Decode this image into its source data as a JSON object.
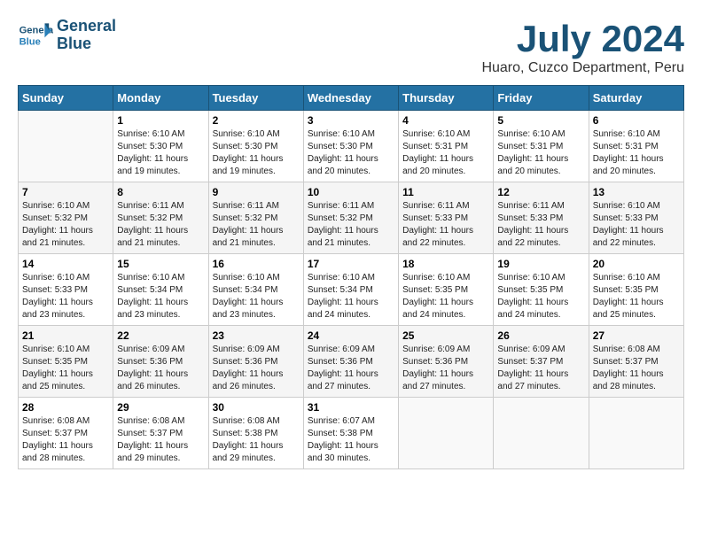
{
  "logo": {
    "line1": "General",
    "line2": "Blue"
  },
  "title": "July 2024",
  "location": "Huaro, Cuzco Department, Peru",
  "days_of_week": [
    "Sunday",
    "Monday",
    "Tuesday",
    "Wednesday",
    "Thursday",
    "Friday",
    "Saturday"
  ],
  "weeks": [
    [
      {
        "num": "",
        "sunrise": "",
        "sunset": "",
        "daylight": ""
      },
      {
        "num": "1",
        "sunrise": "Sunrise: 6:10 AM",
        "sunset": "Sunset: 5:30 PM",
        "daylight": "Daylight: 11 hours and 19 minutes."
      },
      {
        "num": "2",
        "sunrise": "Sunrise: 6:10 AM",
        "sunset": "Sunset: 5:30 PM",
        "daylight": "Daylight: 11 hours and 19 minutes."
      },
      {
        "num": "3",
        "sunrise": "Sunrise: 6:10 AM",
        "sunset": "Sunset: 5:30 PM",
        "daylight": "Daylight: 11 hours and 20 minutes."
      },
      {
        "num": "4",
        "sunrise": "Sunrise: 6:10 AM",
        "sunset": "Sunset: 5:31 PM",
        "daylight": "Daylight: 11 hours and 20 minutes."
      },
      {
        "num": "5",
        "sunrise": "Sunrise: 6:10 AM",
        "sunset": "Sunset: 5:31 PM",
        "daylight": "Daylight: 11 hours and 20 minutes."
      },
      {
        "num": "6",
        "sunrise": "Sunrise: 6:10 AM",
        "sunset": "Sunset: 5:31 PM",
        "daylight": "Daylight: 11 hours and 20 minutes."
      }
    ],
    [
      {
        "num": "7",
        "sunrise": "Sunrise: 6:10 AM",
        "sunset": "Sunset: 5:32 PM",
        "daylight": "Daylight: 11 hours and 21 minutes."
      },
      {
        "num": "8",
        "sunrise": "Sunrise: 6:11 AM",
        "sunset": "Sunset: 5:32 PM",
        "daylight": "Daylight: 11 hours and 21 minutes."
      },
      {
        "num": "9",
        "sunrise": "Sunrise: 6:11 AM",
        "sunset": "Sunset: 5:32 PM",
        "daylight": "Daylight: 11 hours and 21 minutes."
      },
      {
        "num": "10",
        "sunrise": "Sunrise: 6:11 AM",
        "sunset": "Sunset: 5:32 PM",
        "daylight": "Daylight: 11 hours and 21 minutes."
      },
      {
        "num": "11",
        "sunrise": "Sunrise: 6:11 AM",
        "sunset": "Sunset: 5:33 PM",
        "daylight": "Daylight: 11 hours and 22 minutes."
      },
      {
        "num": "12",
        "sunrise": "Sunrise: 6:11 AM",
        "sunset": "Sunset: 5:33 PM",
        "daylight": "Daylight: 11 hours and 22 minutes."
      },
      {
        "num": "13",
        "sunrise": "Sunrise: 6:10 AM",
        "sunset": "Sunset: 5:33 PM",
        "daylight": "Daylight: 11 hours and 22 minutes."
      }
    ],
    [
      {
        "num": "14",
        "sunrise": "Sunrise: 6:10 AM",
        "sunset": "Sunset: 5:33 PM",
        "daylight": "Daylight: 11 hours and 23 minutes."
      },
      {
        "num": "15",
        "sunrise": "Sunrise: 6:10 AM",
        "sunset": "Sunset: 5:34 PM",
        "daylight": "Daylight: 11 hours and 23 minutes."
      },
      {
        "num": "16",
        "sunrise": "Sunrise: 6:10 AM",
        "sunset": "Sunset: 5:34 PM",
        "daylight": "Daylight: 11 hours and 23 minutes."
      },
      {
        "num": "17",
        "sunrise": "Sunrise: 6:10 AM",
        "sunset": "Sunset: 5:34 PM",
        "daylight": "Daylight: 11 hours and 24 minutes."
      },
      {
        "num": "18",
        "sunrise": "Sunrise: 6:10 AM",
        "sunset": "Sunset: 5:35 PM",
        "daylight": "Daylight: 11 hours and 24 minutes."
      },
      {
        "num": "19",
        "sunrise": "Sunrise: 6:10 AM",
        "sunset": "Sunset: 5:35 PM",
        "daylight": "Daylight: 11 hours and 24 minutes."
      },
      {
        "num": "20",
        "sunrise": "Sunrise: 6:10 AM",
        "sunset": "Sunset: 5:35 PM",
        "daylight": "Daylight: 11 hours and 25 minutes."
      }
    ],
    [
      {
        "num": "21",
        "sunrise": "Sunrise: 6:10 AM",
        "sunset": "Sunset: 5:35 PM",
        "daylight": "Daylight: 11 hours and 25 minutes."
      },
      {
        "num": "22",
        "sunrise": "Sunrise: 6:09 AM",
        "sunset": "Sunset: 5:36 PM",
        "daylight": "Daylight: 11 hours and 26 minutes."
      },
      {
        "num": "23",
        "sunrise": "Sunrise: 6:09 AM",
        "sunset": "Sunset: 5:36 PM",
        "daylight": "Daylight: 11 hours and 26 minutes."
      },
      {
        "num": "24",
        "sunrise": "Sunrise: 6:09 AM",
        "sunset": "Sunset: 5:36 PM",
        "daylight": "Daylight: 11 hours and 27 minutes."
      },
      {
        "num": "25",
        "sunrise": "Sunrise: 6:09 AM",
        "sunset": "Sunset: 5:36 PM",
        "daylight": "Daylight: 11 hours and 27 minutes."
      },
      {
        "num": "26",
        "sunrise": "Sunrise: 6:09 AM",
        "sunset": "Sunset: 5:37 PM",
        "daylight": "Daylight: 11 hours and 27 minutes."
      },
      {
        "num": "27",
        "sunrise": "Sunrise: 6:08 AM",
        "sunset": "Sunset: 5:37 PM",
        "daylight": "Daylight: 11 hours and 28 minutes."
      }
    ],
    [
      {
        "num": "28",
        "sunrise": "Sunrise: 6:08 AM",
        "sunset": "Sunset: 5:37 PM",
        "daylight": "Daylight: 11 hours and 28 minutes."
      },
      {
        "num": "29",
        "sunrise": "Sunrise: 6:08 AM",
        "sunset": "Sunset: 5:37 PM",
        "daylight": "Daylight: 11 hours and 29 minutes."
      },
      {
        "num": "30",
        "sunrise": "Sunrise: 6:08 AM",
        "sunset": "Sunset: 5:38 PM",
        "daylight": "Daylight: 11 hours and 29 minutes."
      },
      {
        "num": "31",
        "sunrise": "Sunrise: 6:07 AM",
        "sunset": "Sunset: 5:38 PM",
        "daylight": "Daylight: 11 hours and 30 minutes."
      },
      {
        "num": "",
        "sunrise": "",
        "sunset": "",
        "daylight": ""
      },
      {
        "num": "",
        "sunrise": "",
        "sunset": "",
        "daylight": ""
      },
      {
        "num": "",
        "sunrise": "",
        "sunset": "",
        "daylight": ""
      }
    ]
  ]
}
